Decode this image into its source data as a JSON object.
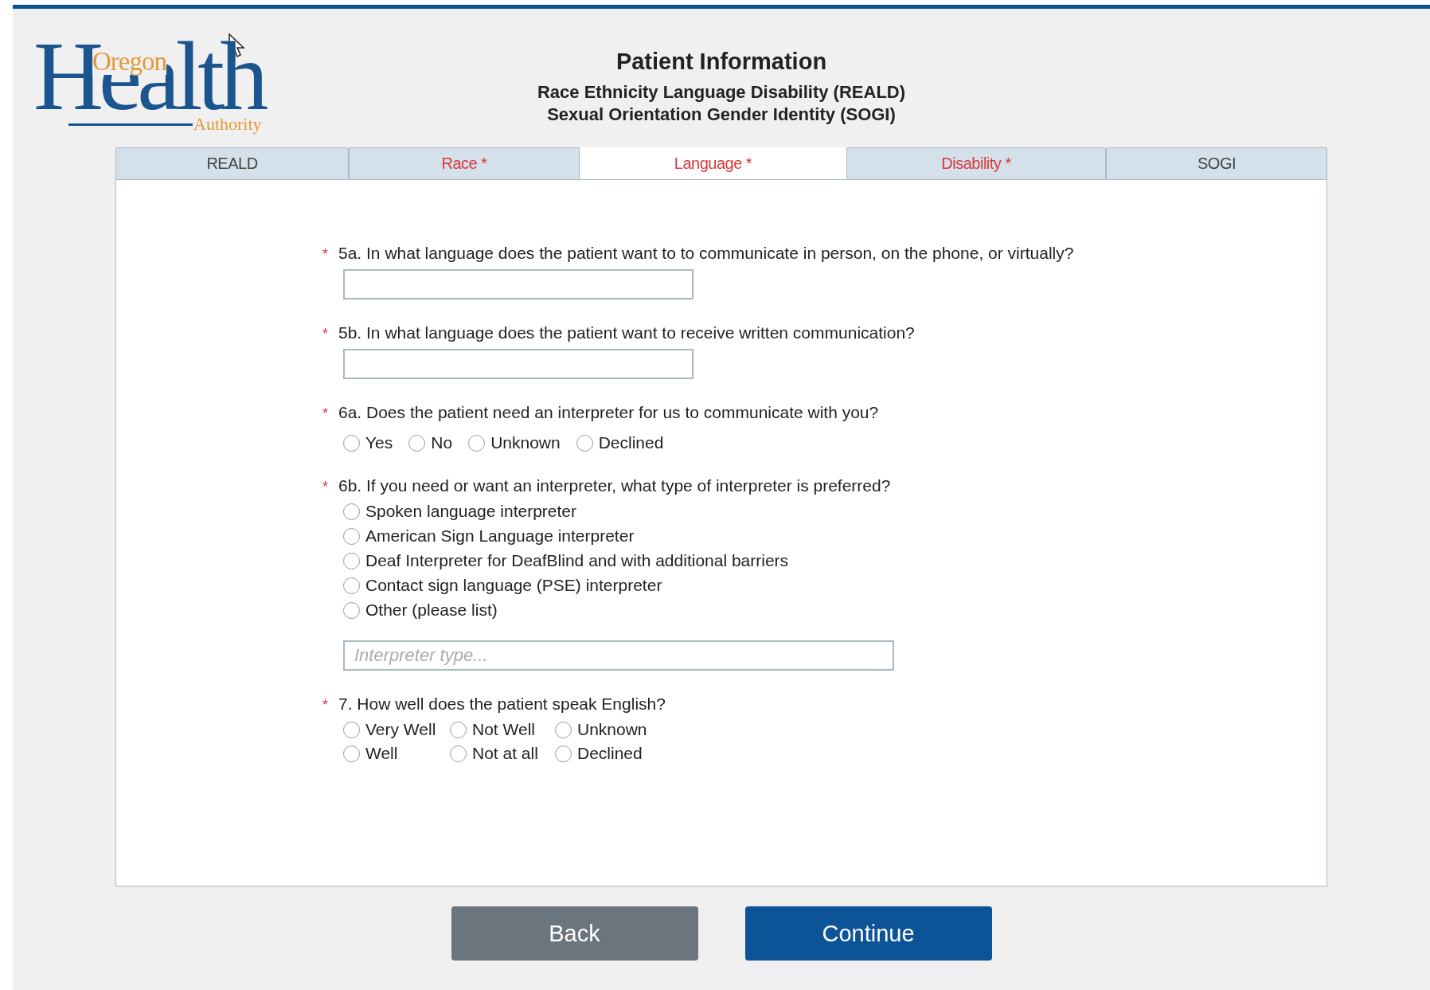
{
  "logo": {
    "top": "Oregon",
    "main": "Health",
    "bottom": "Authority"
  },
  "header": {
    "title": "Patient Information",
    "subtitles": [
      "Race Ethnicity Language Disability (REALD)",
      "Sexual Orientation Gender Identity (SOGI)"
    ]
  },
  "tabs": [
    {
      "label": "REALD",
      "required": false,
      "selected": false
    },
    {
      "label": "Race *",
      "required": true,
      "selected": false
    },
    {
      "label": "Language *",
      "required": true,
      "selected": true
    },
    {
      "label": "Disability *",
      "required": true,
      "selected": false
    },
    {
      "label": "SOGI",
      "required": false,
      "selected": false
    }
  ],
  "questions": [
    {
      "kind": "text",
      "marker": "*",
      "text": "5a. In what language does the patient want to to communicate in person, on the phone, or virtually?"
    },
    {
      "kind": "text",
      "marker": "*",
      "text": "5b. In what language does the patient want to receive written communication?"
    },
    {
      "kind": "row",
      "marker": "*",
      "text": "6a. Does the patient need an interpreter for us to communicate with you?",
      "options": [
        {
          "label": "Yes",
          "selected": false
        },
        {
          "label": "No",
          "selected": false
        },
        {
          "label": "Unknown",
          "selected": false
        },
        {
          "label": "Declined",
          "selected": false
        }
      ]
    },
    {
      "kind": "list",
      "marker": "*",
      "text": "6b. If you need or want an interpreter, what type of interpreter is preferred?",
      "options": [
        {
          "label": "Spoken language interpreter",
          "selected": false
        },
        {
          "label": "American Sign Language interpreter",
          "selected": false
        },
        {
          "label": "Deaf Interpreter for DeafBlind and with additional barriers",
          "selected": false
        },
        {
          "label": "Contact sign language (PSE) interpreter",
          "selected": false
        },
        {
          "label": "Other (please list)",
          "selected": false
        }
      ],
      "placeholder": "Interpreter type..."
    },
    {
      "kind": "grid",
      "marker": "*",
      "text": "7. How well does the patient speak English?",
      "options": [
        {
          "label": "Very Well",
          "selected": false
        },
        {
          "label": "Not Well",
          "selected": false
        },
        {
          "label": "Unknown",
          "selected": false
        },
        {
          "label": "Well",
          "selected": false
        },
        {
          "label": "Not at all",
          "selected": false
        },
        {
          "label": "Declined",
          "selected": false
        }
      ]
    }
  ],
  "buttons": [
    {
      "label": "Back",
      "kind": "secondary"
    },
    {
      "label": "Continue",
      "kind": "primary"
    }
  ]
}
